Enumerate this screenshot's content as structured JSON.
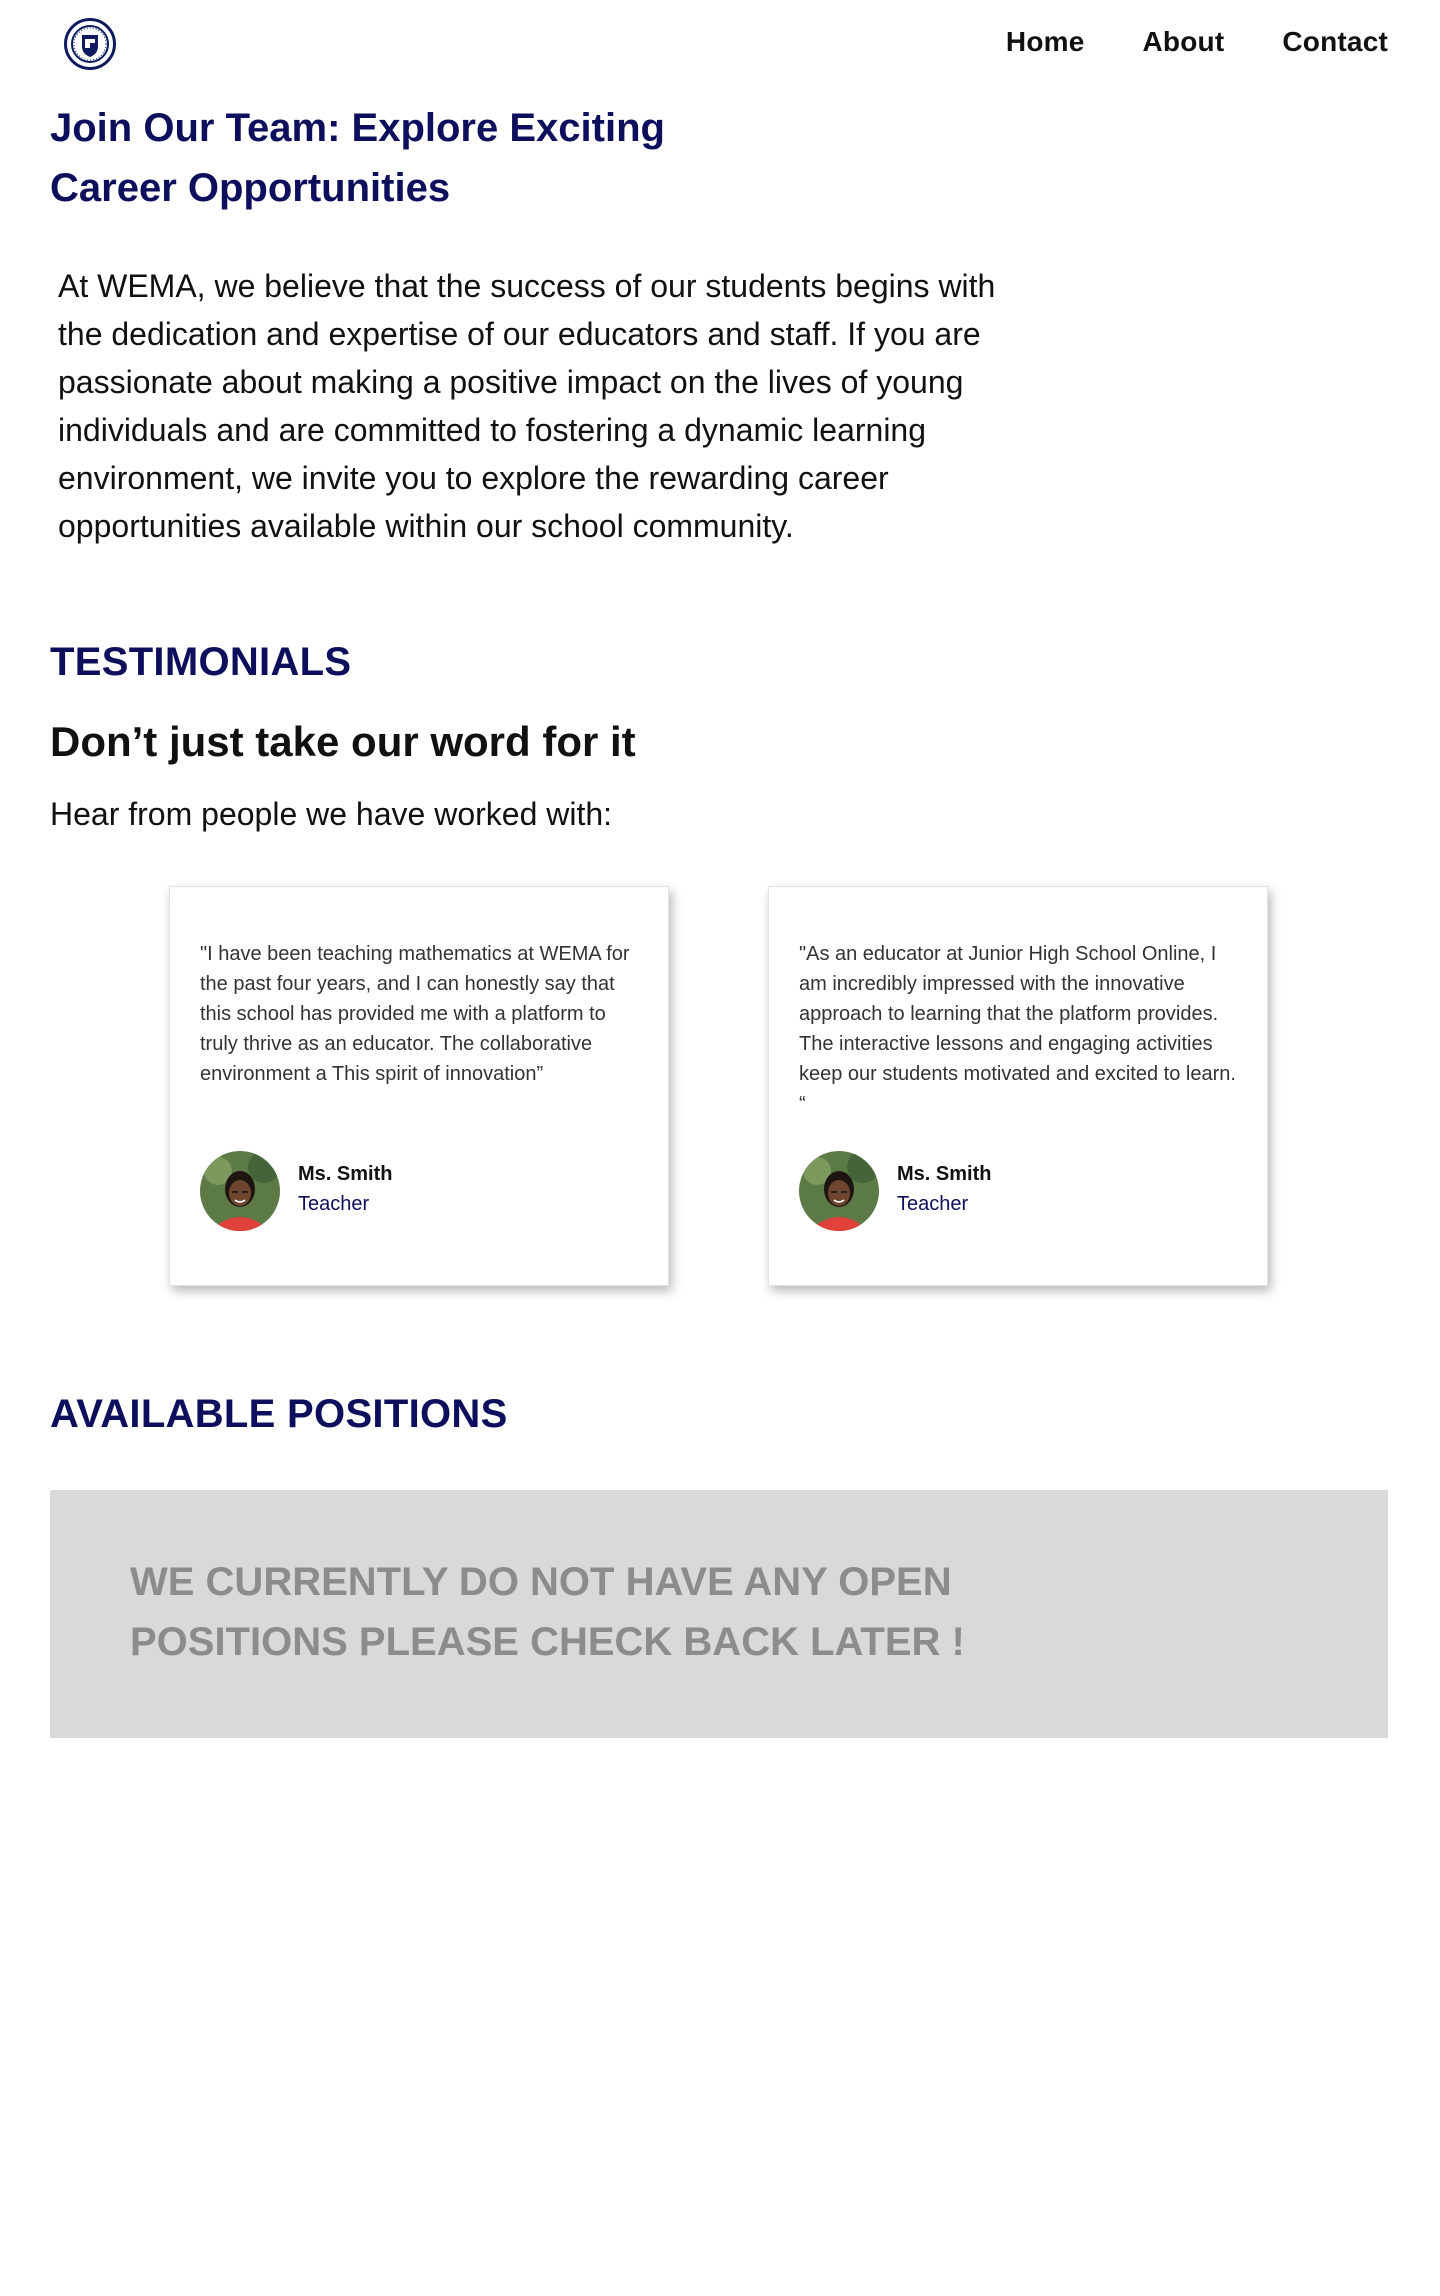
{
  "nav": {
    "items": [
      {
        "label": "Home"
      },
      {
        "label": "About"
      },
      {
        "label": "Contact"
      }
    ]
  },
  "hero": {
    "title": "Join Our Team: Explore Exciting Career Opportunities",
    "intro": "At WEMA, we believe that the success of our students begins with the dedication and expertise of our educators and staff. If you are passionate about making a positive impact on the lives of young individuals and are committed to fostering a dynamic learning environment, we invite you to explore the rewarding career opportunities available within our school community."
  },
  "testimonials": {
    "heading": "TESTIMONIALS",
    "tagline": "Don’t just take our word for it",
    "subtagline": "Hear from people we have worked with:",
    "cards": [
      {
        "quote": "\"I have been teaching mathematics at WEMA for the past four years, and I can honestly say that this school has provided me with a platform to truly thrive as an educator. The collaborative environment a This spirit of innovation”",
        "name": "Ms. Smith",
        "role": "Teacher"
      },
      {
        "quote": "\"As an educator at Junior High School Online, I am incredibly impressed with the innovative approach to learning that the platform provides. The interactive lessons and engaging activities keep our students motivated and excited to learn. “",
        "name": "Ms. Smith",
        "role": "Teacher"
      }
    ]
  },
  "positions": {
    "heading": "AVAILABLE POSITIONS",
    "message": "WE CURRENTLY DO NOT HAVE ANY OPEN POSITIONS PLEASE CHECK BACK LATER !"
  },
  "colors": {
    "brand_navy": "#0d0f5c",
    "panel_gray": "#d9d9d9",
    "muted_text": "#8c8c8c"
  }
}
